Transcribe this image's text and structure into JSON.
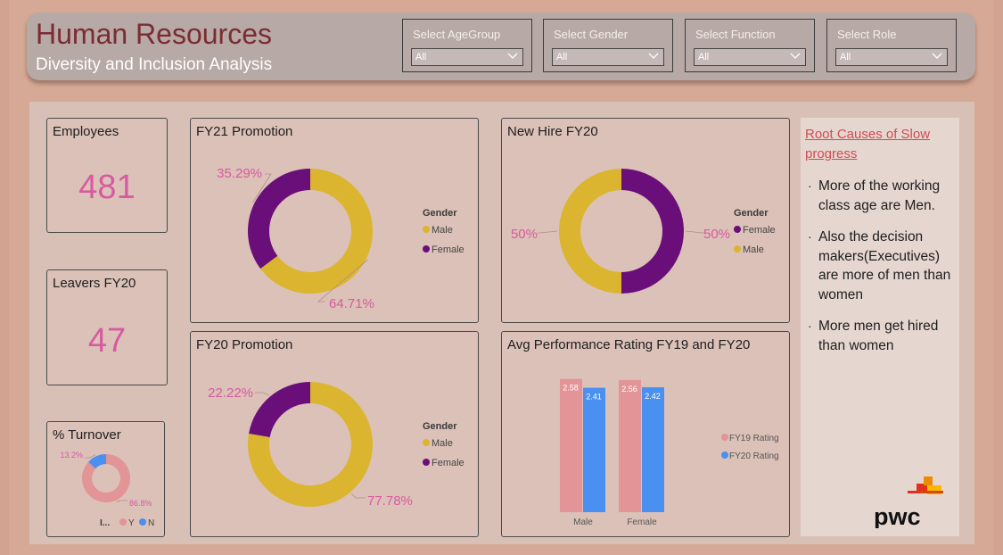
{
  "header": {
    "title": "Human Resources",
    "subtitle": "Diversity and Inclusion Analysis"
  },
  "filters": [
    {
      "label": "Select AgeGroup",
      "value": "All"
    },
    {
      "label": "Select Gender",
      "value": "All"
    },
    {
      "label": "Select Function",
      "value": "All"
    },
    {
      "label": "Select Role",
      "value": "All"
    }
  ],
  "kpis": {
    "employees": {
      "label": "Employees",
      "value": "481"
    },
    "leavers": {
      "label": "Leavers FY20",
      "value": "47"
    }
  },
  "notes": {
    "title": "Root Causes of Slow progress",
    "items": [
      "More of the working class age are Men.",
      "Also the decision makers(Executives) are more of men than women",
      "More men get hired than women"
    ]
  },
  "logo": {
    "text": "pwc"
  },
  "colors": {
    "male": "#dbb52f",
    "female": "#6a0f7a",
    "fy19": "#e29497",
    "fy20": "#4a90f0",
    "turnover_yes": "#e29497",
    "turnover_no": "#4a90f0",
    "label_pink": "#d95aa0"
  },
  "chart_data": [
    {
      "id": "fy21-promotion",
      "type": "pie",
      "title": "FY21 Promotion",
      "legend_title": "Gender",
      "legend": [
        "Male",
        "Female"
      ],
      "slices": [
        {
          "name": "Male",
          "value": 64.71,
          "label": "64.71%"
        },
        {
          "name": "Female",
          "value": 35.29,
          "label": "35.29%"
        }
      ]
    },
    {
      "id": "new-hire-fy20",
      "type": "pie",
      "title": "New Hire FY20",
      "legend_title": "Gender",
      "legend": [
        "Female",
        "Male"
      ],
      "slices": [
        {
          "name": "Female",
          "value": 50,
          "label": "50%"
        },
        {
          "name": "Male",
          "value": 50,
          "label": "50%"
        }
      ]
    },
    {
      "id": "fy20-promotion",
      "type": "pie",
      "title": "FY20 Promotion",
      "legend_title": "Gender",
      "legend": [
        "Male",
        "Female"
      ],
      "slices": [
        {
          "name": "Male",
          "value": 77.78,
          "label": "77.78%"
        },
        {
          "name": "Female",
          "value": 22.22,
          "label": "22.22%"
        }
      ]
    },
    {
      "id": "avg-performance",
      "type": "bar",
      "title": "Avg Performance Rating FY19 and FY20",
      "categories": [
        "Male",
        "Female"
      ],
      "series": [
        {
          "name": "FY19 Rating",
          "values": [
            2.58,
            2.56
          ]
        },
        {
          "name": "FY20 Rating",
          "values": [
            2.41,
            2.42
          ]
        }
      ],
      "ylim": [
        0,
        2.8
      ]
    },
    {
      "id": "turnover",
      "type": "pie",
      "title": "% Turnover",
      "legend_title": "I...",
      "legend": [
        "Y",
        "N"
      ],
      "slices": [
        {
          "name": "Y",
          "value": 86.8,
          "label": "86.8%"
        },
        {
          "name": "N",
          "value": 13.2,
          "label": "13.2%"
        }
      ]
    }
  ]
}
